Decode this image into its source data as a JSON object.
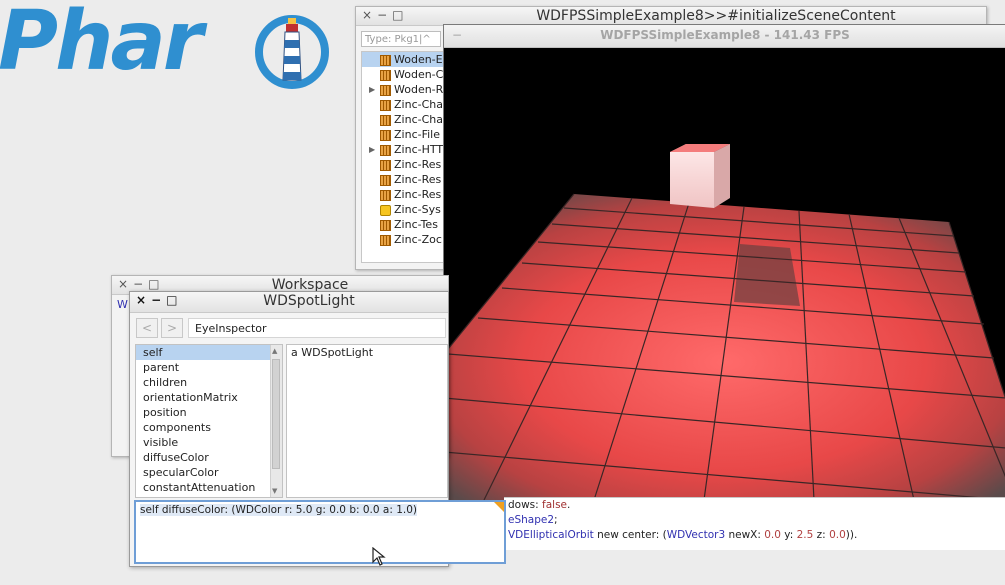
{
  "logo": {
    "text": "Phar"
  },
  "browser": {
    "title": "WDFPSSimpleExample8>>#initializeSceneContent",
    "controls": [
      "×",
      "−",
      "□"
    ],
    "search_placeholder": "Type: Pkg1|^",
    "packages": [
      {
        "label": "Woden-E",
        "expandable": false,
        "selected": true,
        "icon": "package-icon"
      },
      {
        "label": "Woden-C",
        "expandable": false,
        "icon": "package-icon"
      },
      {
        "label": "Woden-R",
        "expandable": true,
        "icon": "package-icon"
      },
      {
        "label": "Zinc-Cha",
        "expandable": false,
        "icon": "package-icon"
      },
      {
        "label": "Zinc-Cha",
        "expandable": false,
        "icon": "package-icon"
      },
      {
        "label": "Zinc-File",
        "expandable": false,
        "icon": "package-icon"
      },
      {
        "label": "Zinc-HTT",
        "expandable": true,
        "icon": "package-icon"
      },
      {
        "label": "Zinc-Res",
        "expandable": false,
        "icon": "package-icon"
      },
      {
        "label": "Zinc-Res",
        "expandable": false,
        "icon": "package-icon"
      },
      {
        "label": "Zinc-Res",
        "expandable": false,
        "icon": "package-icon"
      },
      {
        "label": "Zinc-Sys",
        "expandable": false,
        "icon": "lock-icon"
      },
      {
        "label": "Zinc-Tes",
        "expandable": false,
        "icon": "package-icon"
      },
      {
        "label": "Zinc-Zoc",
        "expandable": false,
        "icon": "package-icon"
      }
    ]
  },
  "view3d": {
    "title": "WDFPSSimpleExample8 - 141.43 FPS",
    "close_glyph": "−"
  },
  "code": {
    "line1": [
      {
        "t": "dows: ",
        "c": ""
      },
      {
        "t": "false",
        "c": "kw"
      },
      {
        "t": ".",
        "c": ""
      }
    ],
    "line2": [
      {
        "t": "eShape2",
        "c": "cls"
      },
      {
        "t": ";",
        "c": ""
      }
    ],
    "line3": [
      {
        "t": "VDEllipticalOrbit",
        "c": "cls"
      },
      {
        "t": " new center: (",
        "c": ""
      },
      {
        "t": "WDVector3",
        "c": "cls"
      },
      {
        "t": " newX: ",
        "c": ""
      },
      {
        "t": "0.0",
        "c": "num"
      },
      {
        "t": " y: ",
        "c": ""
      },
      {
        "t": "2.5",
        "c": "num"
      },
      {
        "t": " z: ",
        "c": ""
      },
      {
        "t": "0.0",
        "c": "num"
      },
      {
        "t": ")).",
        "c": ""
      }
    ]
  },
  "workspace": {
    "title": "Workspace",
    "controls": [
      "×",
      "−",
      "□"
    ],
    "fragment": "W"
  },
  "inspector": {
    "title": "WDSpotLight",
    "controls": [
      "×",
      "−",
      "□"
    ],
    "back_glyph": "<",
    "forward_glyph": ">",
    "inspector_name": "EyeInspector",
    "fields": [
      "self",
      "parent",
      "children",
      "orientationMatrix",
      "position",
      "components",
      "visible",
      "diffuseColor",
      "specularColor",
      "constantAttenuation"
    ],
    "selected_field": "self",
    "value": "a WDSpotLight",
    "eval_text": "self diffuseColor: (WDColor r: 5.0 g: 0.0 b: 0.0 a: 1.0)"
  },
  "colors": {
    "logo_blue": "#2f8fd0",
    "floor_red": "#e8504f",
    "cube_pink": "#f5c9c9",
    "selection": "#b8d3f0"
  }
}
